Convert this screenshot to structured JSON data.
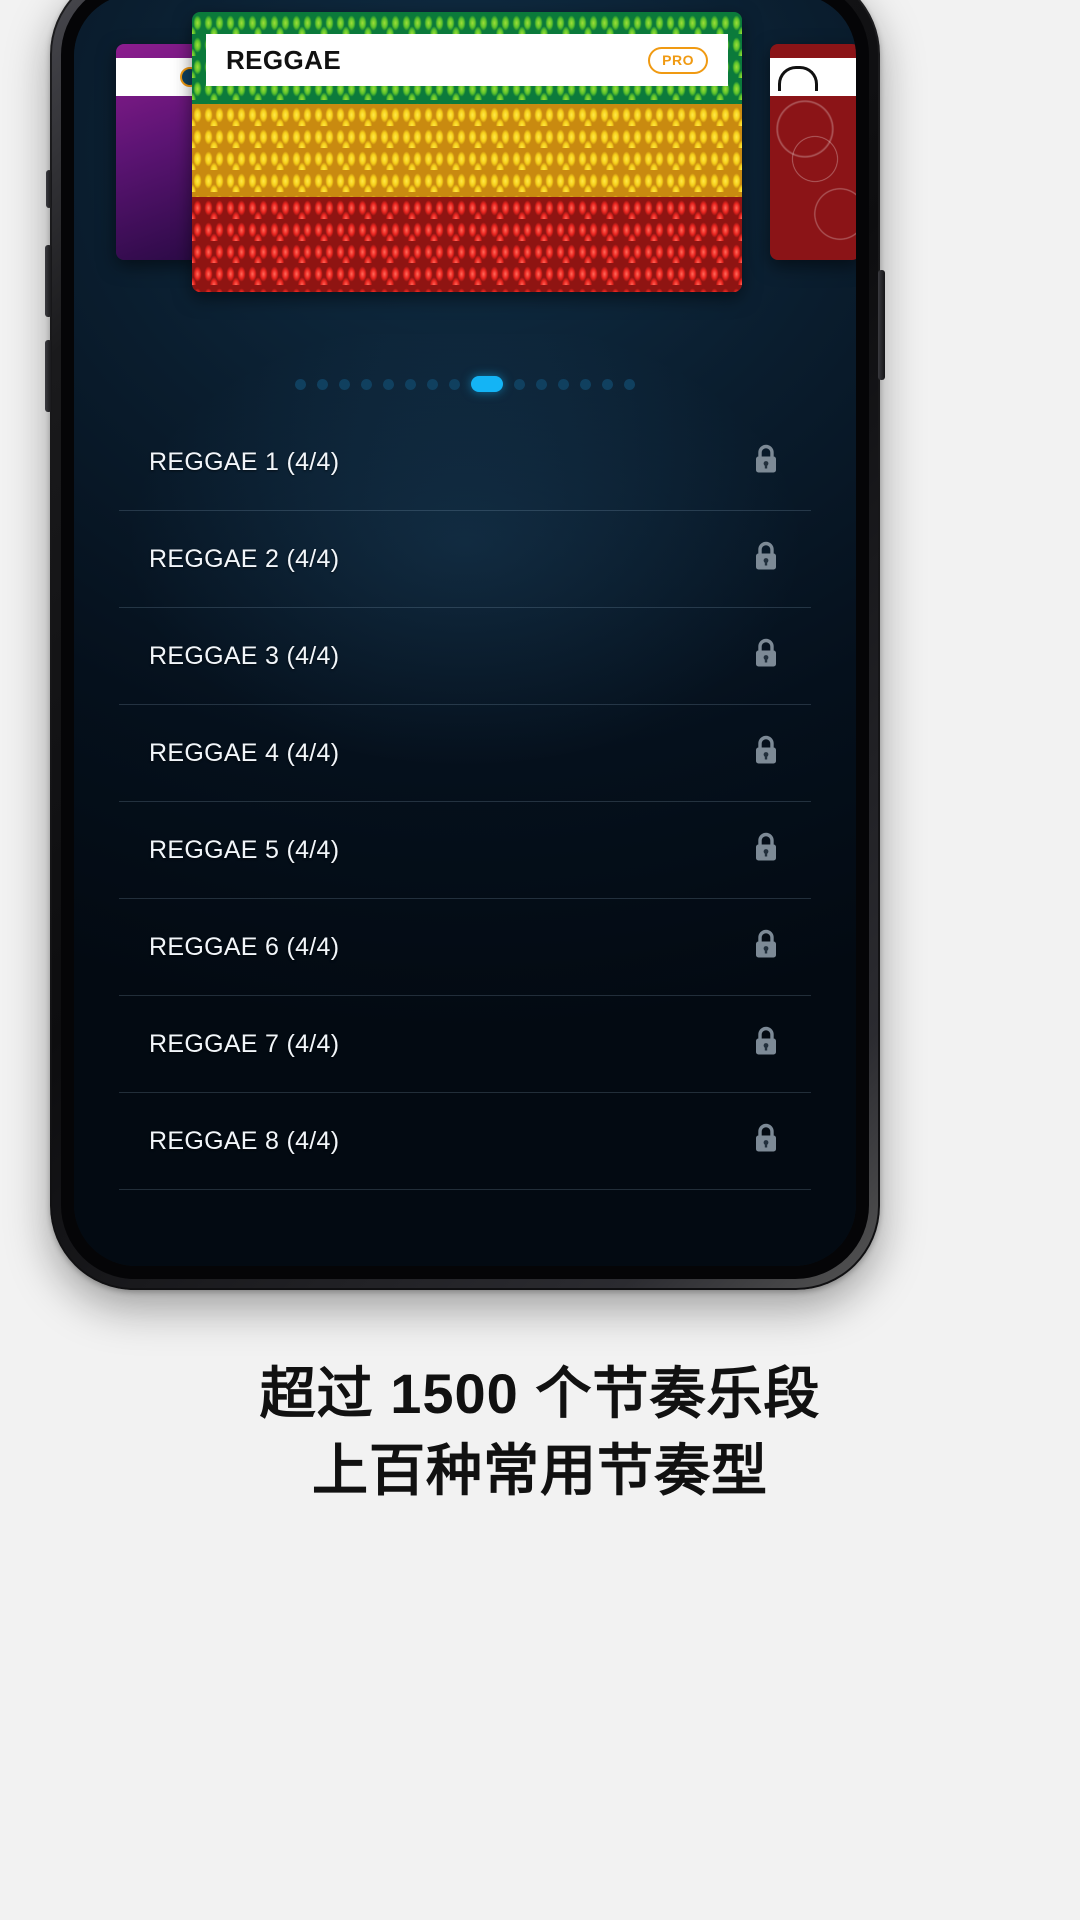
{
  "card": {
    "title": "REGGAE",
    "badge": "PRO",
    "colors": {
      "green": "#0b7a3b",
      "yellow": "#f5cf1a",
      "red": "#e8251f",
      "badge_outline": "#f09a12"
    }
  },
  "pager": {
    "total": 15,
    "active_index": 9,
    "active_color": "#14b4f5",
    "inactive_color": "#10405f"
  },
  "list": {
    "icon": "lock-icon",
    "rows": [
      {
        "label": "REGGAE 1 (4/4)",
        "locked": true
      },
      {
        "label": "REGGAE 2 (4/4)",
        "locked": true
      },
      {
        "label": "REGGAE 3 (4/4)",
        "locked": true
      },
      {
        "label": "REGGAE 4 (4/4)",
        "locked": true
      },
      {
        "label": "REGGAE 5 (4/4)",
        "locked": true
      },
      {
        "label": "REGGAE 6 (4/4)",
        "locked": true
      },
      {
        "label": "REGGAE 7 (4/4)",
        "locked": true
      },
      {
        "label": "REGGAE 8 (4/4)",
        "locked": true
      }
    ]
  },
  "caption": {
    "line1": "超过 1500 个节奏乐段",
    "line2": "上百种常用节奏型"
  }
}
